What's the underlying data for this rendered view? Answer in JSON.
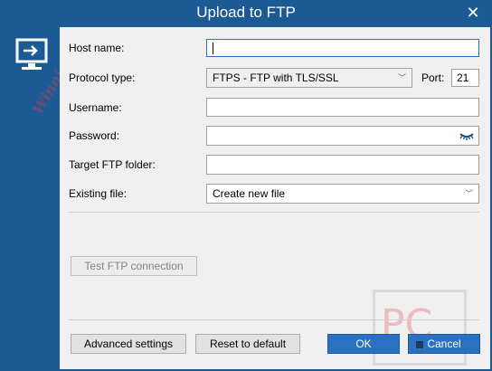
{
  "window": {
    "title": "Upload to FTP"
  },
  "form": {
    "host_label": "Host name:",
    "host_value": "",
    "protocol_label": "Protocol type:",
    "protocol_value": "FTPS - FTP with TLS/SSL",
    "port_label": "Port:",
    "port_value": "21",
    "username_label": "Username:",
    "username_value": "",
    "password_label": "Password:",
    "password_value": "",
    "folder_label": "Target FTP folder:",
    "folder_value": "",
    "existing_label": "Existing file:",
    "existing_value": "Create new file"
  },
  "buttons": {
    "test": "Test FTP connection",
    "advanced": "Advanced settings",
    "reset": "Reset to default",
    "ok": "OK",
    "cancel": "Cancel"
  },
  "watermark": {
    "left_text": "WinningPC",
    "pc_text": "PC"
  },
  "colors": {
    "accent": "#1b5a95",
    "primary_button": "#2a71c2",
    "dialog_bg": "#f0f0f0"
  }
}
